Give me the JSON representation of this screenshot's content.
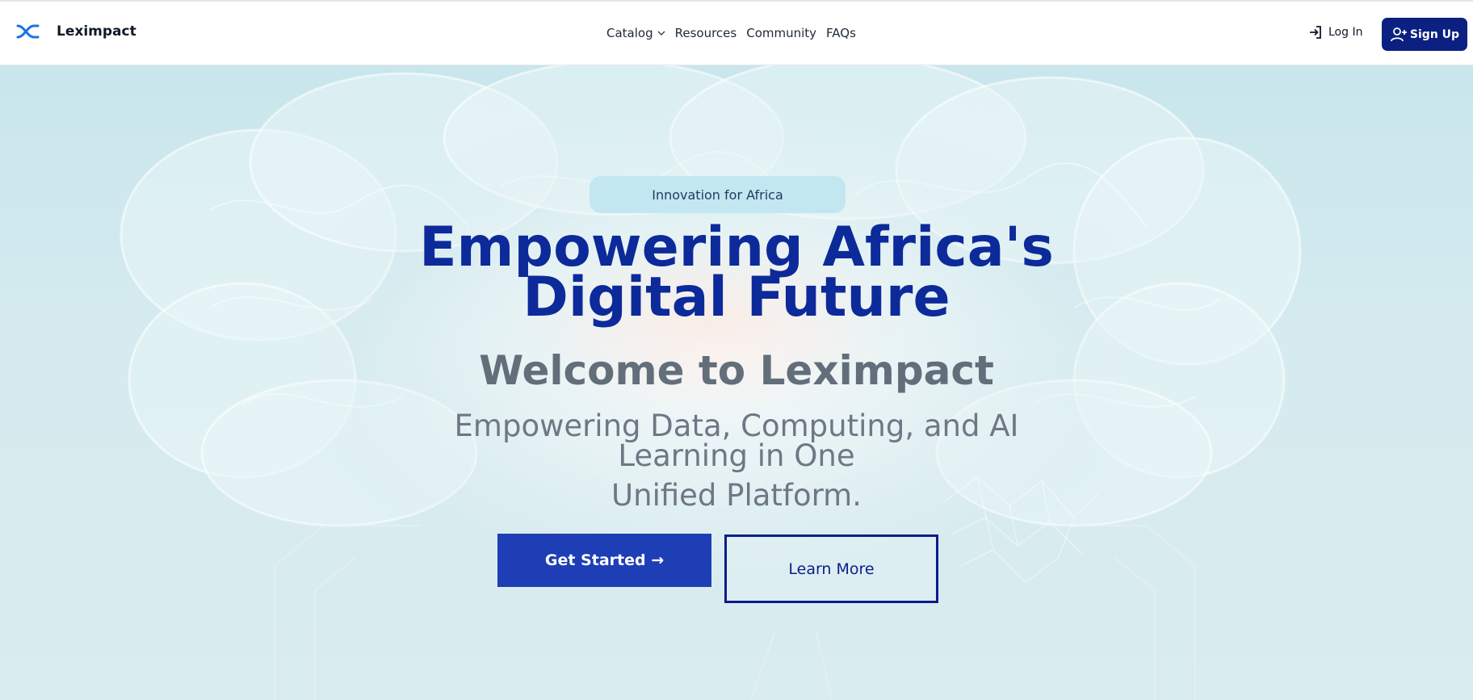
{
  "brand": {
    "name": "Leximpact",
    "logo_icon": "crossed-arrows-logo-icon",
    "accent": "#1a73e8"
  },
  "nav": {
    "items": [
      {
        "label": "Catalog",
        "has_dropdown": true
      },
      {
        "label": "Resources"
      },
      {
        "label": "Community"
      },
      {
        "label": "FAQs"
      }
    ]
  },
  "auth": {
    "login_label": "Log In",
    "signup_label": "Sign Up",
    "signup_color": "#0b2080"
  },
  "hero": {
    "badge": "Innovation for Africa",
    "title_line1": "Empowering Africa's",
    "title_line2": "Digital Future",
    "welcome": "Welcome to Leximpact",
    "subtitle_line1": "Empowering Data, Computing, and AI",
    "subtitle_line2": "Learning in One",
    "subtitle_line3": "Unified Platform.",
    "primary_button": "Get Started →",
    "secondary_button": "Learn More",
    "primary_color": "#1d3eb4",
    "title_color": "#0d2a9a"
  }
}
